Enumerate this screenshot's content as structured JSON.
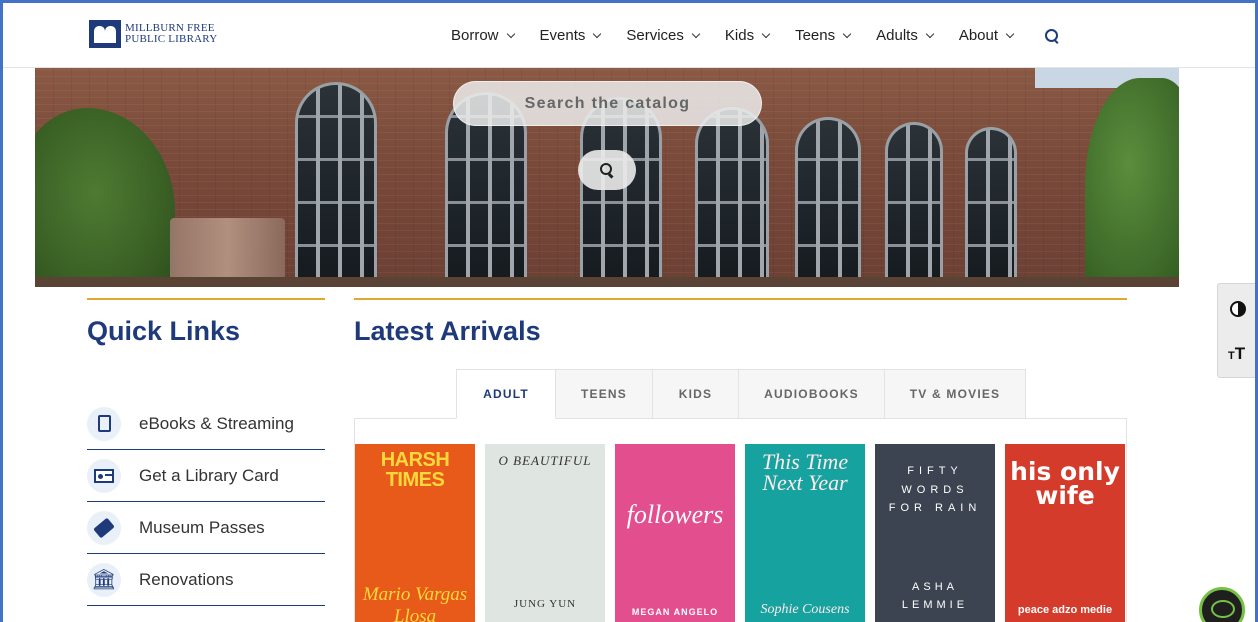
{
  "header": {
    "logo_line1": "MILLBURN FREE",
    "logo_line2": "PUBLIC LIBRARY",
    "nav": [
      "Borrow",
      "Events",
      "Services",
      "Kids",
      "Teens",
      "Adults",
      "About"
    ]
  },
  "hero": {
    "search_placeholder": "Search the catalog"
  },
  "quick_links": {
    "title": "Quick Links",
    "items": [
      {
        "label": "eBooks & Streaming",
        "icon": "tablet-icon"
      },
      {
        "label": "Get a Library Card",
        "icon": "library-card-icon"
      },
      {
        "label": "Museum Passes",
        "icon": "ticket-icon"
      },
      {
        "label": "Renovations",
        "icon": "building-icon"
      }
    ]
  },
  "latest": {
    "title": "Latest Arrivals",
    "tabs": [
      "ADULT",
      "TEENS",
      "KIDS",
      "AUDIOBOOKS",
      "TV & MOVIES"
    ],
    "active_tab": "ADULT",
    "books": [
      {
        "title": "HARSH TIMES",
        "author": "Mario Vargas Llosa",
        "bg": "#e85a1a",
        "fg": "#ffd93b"
      },
      {
        "title": "O BEAUTIFUL",
        "author": "JUNG YUN",
        "bg": "#dfe5e0",
        "fg": "#333333"
      },
      {
        "title": "followers",
        "author": "MEGAN ANGELO",
        "bg": "#e34e8f",
        "fg": "#ffffff"
      },
      {
        "title": "This Time Next Year",
        "author": "Sophie Cousens",
        "bg": "#16a3a0",
        "fg": "#ffe8ea"
      },
      {
        "title": "FIFTY WORDS FOR RAIN",
        "author": "ASHA LEMMIE",
        "bg": "#3b4450",
        "fg": "#ffffff"
      },
      {
        "title": "his only wife",
        "author": "peace adzo medie",
        "bg": "#d53b2b",
        "fg": "#ffffff"
      }
    ]
  },
  "colors": {
    "brand": "#1e3a7b",
    "accent": "#e0a82e",
    "chat_accent": "#76c043"
  }
}
